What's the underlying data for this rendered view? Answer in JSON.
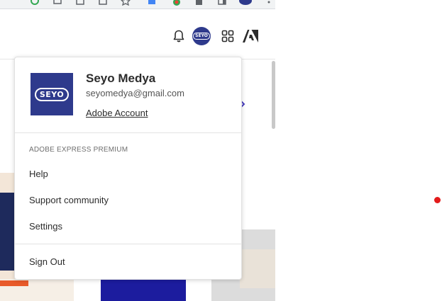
{
  "header": {
    "avatar_text": "SEYO"
  },
  "profile": {
    "avatar_text": "SEYO",
    "name": "Seyo Medya",
    "email": "seyomedya@gmail.com",
    "account_link": "Adobe Account"
  },
  "plan_label": "ADOBE EXPRESS PREMIUM",
  "menu": {
    "help": "Help",
    "support": "Support community",
    "settings": "Settings",
    "sign_out": "Sign Out"
  },
  "colors": {
    "avatar_bg": "#2e3a8c",
    "indicator": "#e31b1b"
  }
}
